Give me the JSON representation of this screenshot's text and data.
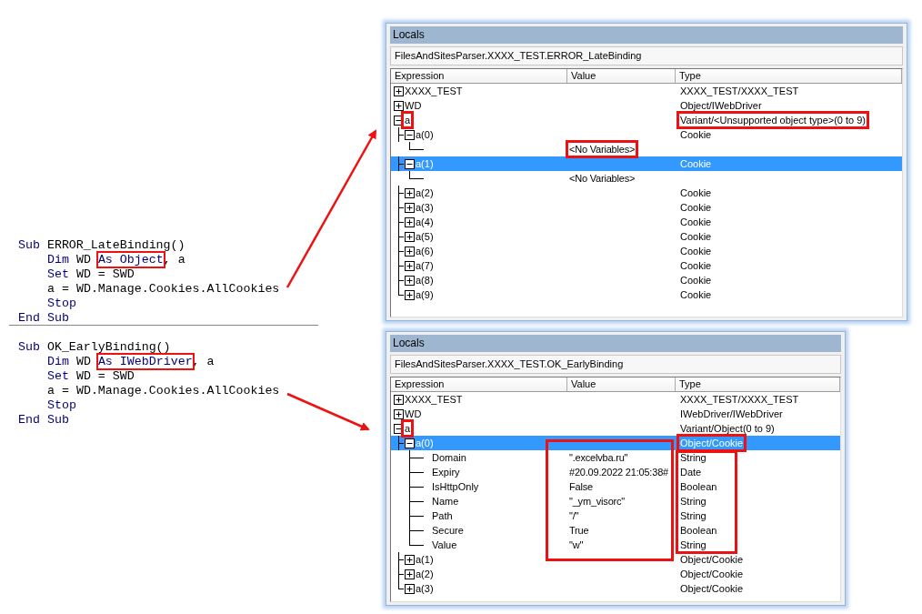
{
  "code_blocks": [
    {
      "header": [
        {
          "text": "Sub",
          "kind": "keyword"
        },
        {
          "text": " ERROR_LateBinding()",
          "kind": "plain"
        }
      ],
      "body": [
        [
          {
            "text": "Dim",
            "kind": "keyword"
          },
          {
            "text": " WD ",
            "kind": "plain"
          },
          {
            "text": "As Object",
            "kind": "keyword",
            "boxed": true
          },
          {
            "text": ", a",
            "kind": "plain"
          }
        ],
        [
          {
            "text": "Set",
            "kind": "keyword"
          },
          {
            "text": " WD = SWD",
            "kind": "plain"
          }
        ],
        [
          {
            "text": "a = WD.Manage.Cookies.AllCookies",
            "kind": "plain"
          }
        ],
        [
          {
            "text": "Stop",
            "kind": "keyword"
          }
        ]
      ],
      "footer": [
        {
          "text": "End Sub",
          "kind": "keyword"
        }
      ]
    },
    {
      "header": [
        {
          "text": "Sub",
          "kind": "keyword"
        },
        {
          "text": " OK_EarlyBinding()",
          "kind": "plain"
        }
      ],
      "body": [
        [
          {
            "text": "Dim",
            "kind": "keyword"
          },
          {
            "text": " WD ",
            "kind": "plain"
          },
          {
            "text": "As IWebDriver",
            "kind": "keyword",
            "boxed": true
          },
          {
            "text": ", a",
            "kind": "plain"
          }
        ],
        [
          {
            "text": "Set",
            "kind": "keyword"
          },
          {
            "text": " WD = SWD",
            "kind": "plain"
          }
        ],
        [
          {
            "text": "a = WD.Manage.Cookies.AllCookies",
            "kind": "plain"
          }
        ],
        [
          {
            "text": "Stop",
            "kind": "keyword"
          }
        ]
      ],
      "footer": [
        {
          "text": "End Sub",
          "kind": "keyword"
        }
      ]
    }
  ],
  "locals_windows": [
    {
      "title": "Locals",
      "context": "FilesAndSitesParser.XXXX_TEST.ERROR_LateBinding",
      "columns": [
        "Expression",
        "Value",
        "Type"
      ],
      "rows": [
        {
          "expression": "XXXX_TEST",
          "type": "XXXX_TEST/XXXX_TEST",
          "expanded": false,
          "selected": false
        },
        {
          "expression": "WD",
          "type": "Object/IWebDriver",
          "expanded": false,
          "selected": false
        },
        {
          "expression": "a",
          "type": "Variant/<Unsupported object type>(0 to 9)",
          "expanded": true,
          "selected": false,
          "expression_boxed": true,
          "type_boxed": true,
          "children": [
            {
              "expression": "a(0)",
              "type": "Cookie",
              "expanded": true,
              "selected": false,
              "children": [
                {
                  "value": "<No Variables>",
                  "selected": false,
                  "value_boxed": true
                }
              ]
            },
            {
              "expression": "a(1)",
              "type": "Cookie",
              "expanded": true,
              "selected": true,
              "children": [
                {
                  "value": "<No Variables>",
                  "selected": false
                }
              ]
            },
            {
              "expression": "a(2)",
              "type": "Cookie",
              "expanded": false,
              "selected": false
            },
            {
              "expression": "a(3)",
              "type": "Cookie",
              "expanded": false,
              "selected": false
            },
            {
              "expression": "a(4)",
              "type": "Cookie",
              "expanded": false,
              "selected": false
            },
            {
              "expression": "a(5)",
              "type": "Cookie",
              "expanded": false,
              "selected": false
            },
            {
              "expression": "a(6)",
              "type": "Cookie",
              "expanded": false,
              "selected": false
            },
            {
              "expression": "a(7)",
              "type": "Cookie",
              "expanded": false,
              "selected": false
            },
            {
              "expression": "a(8)",
              "type": "Cookie",
              "expanded": false,
              "selected": false
            },
            {
              "expression": "a(9)",
              "type": "Cookie",
              "expanded": false,
              "selected": false
            }
          ]
        }
      ]
    },
    {
      "title": "Locals",
      "context": "FilesAndSitesParser.XXXX_TEST.OK_EarlyBinding",
      "columns": [
        "Expression",
        "Value",
        "Type"
      ],
      "rows": [
        {
          "expression": "XXXX_TEST",
          "type": "XXXX_TEST/XXXX_TEST",
          "expanded": false,
          "selected": false
        },
        {
          "expression": "WD",
          "type": "IWebDriver/IWebDriver",
          "expanded": false,
          "selected": false
        },
        {
          "expression": "a",
          "type": "Variant/Object(0 to 9)",
          "expanded": true,
          "selected": false,
          "expression_boxed": true,
          "children": [
            {
              "expression": "a(0)",
              "type": "Object/Cookie",
              "expanded": true,
              "selected": true,
              "type_boxed": true,
              "child_values_boxed": true,
              "child_types_boxed": true,
              "children": [
                {
                  "expression": "Domain",
                  "value": "\".excelvba.ru\"",
                  "type": "String",
                  "selected": false
                },
                {
                  "expression": "Expiry",
                  "value": "#20.09.2022 21:05:38#",
                  "type": "Date",
                  "selected": false
                },
                {
                  "expression": "IsHttpOnly",
                  "value": "False",
                  "type": "Boolean",
                  "selected": false
                },
                {
                  "expression": "Name",
                  "value": "\"_ym_visorc\"",
                  "type": "String",
                  "selected": false
                },
                {
                  "expression": "Path",
                  "value": "\"/\"",
                  "type": "String",
                  "selected": false
                },
                {
                  "expression": "Secure",
                  "value": "True",
                  "type": "Boolean",
                  "selected": false
                },
                {
                  "expression": "Value",
                  "value": "\"w\"",
                  "type": "String",
                  "selected": false
                }
              ]
            },
            {
              "expression": "a(1)",
              "type": "Object/Cookie",
              "expanded": false,
              "selected": false
            },
            {
              "expression": "a(2)",
              "type": "Object/Cookie",
              "expanded": false,
              "selected": false
            },
            {
              "expression": "a(3)",
              "type": "Object/Cookie",
              "expanded": false,
              "selected": false
            }
          ]
        }
      ]
    }
  ]
}
